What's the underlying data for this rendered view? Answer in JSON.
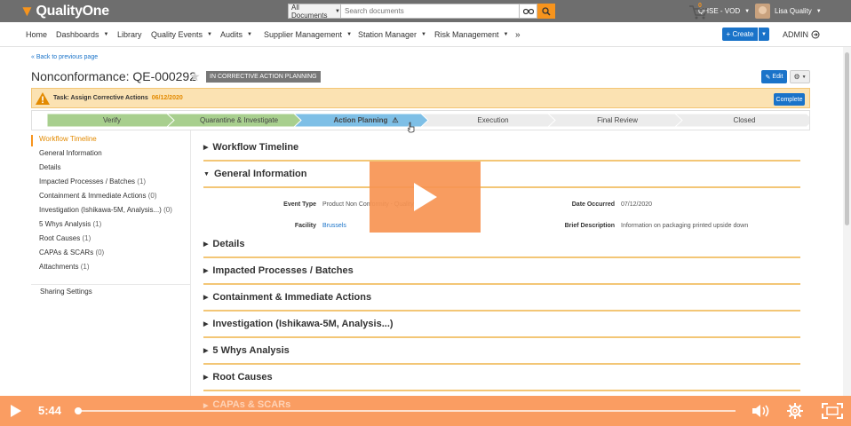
{
  "app": {
    "name": "QualityOne"
  },
  "search": {
    "scope": "All Documents",
    "placeholder": "Search documents"
  },
  "topbar": {
    "environment": "QHSE - VOD",
    "user_name": "Lisa Quality"
  },
  "nav": {
    "items": [
      "Home",
      "Dashboards",
      "Library",
      "Quality Events",
      "Audits",
      "Supplier Management",
      "Station Manager",
      "Risk Management"
    ],
    "cart_count": "0",
    "create_label": "+ Create",
    "admin_label": "ADMIN"
  },
  "page": {
    "back_link": "« Back to previous page",
    "title": "Nonconformance: QE-000292",
    "status": "IN CORRECTIVE ACTION PLANNING",
    "edit_label": "Edit"
  },
  "task": {
    "label": "Task: Assign Corrective Actions",
    "date": "06/12/2020",
    "complete_label": "Complete"
  },
  "workflow": {
    "steps": [
      {
        "label": "Verify",
        "state": "done"
      },
      {
        "label": "Quarantine & Investigate",
        "state": "done"
      },
      {
        "label": "Action Planning",
        "state": "current"
      },
      {
        "label": "Execution",
        "state": "pending"
      },
      {
        "label": "Final Review",
        "state": "pending"
      },
      {
        "label": "Closed",
        "state": "pending"
      }
    ],
    "colors": {
      "done": "#a8cf8e",
      "current": "#7ebfe6",
      "pending": "#ececec"
    }
  },
  "sidebar": {
    "items": [
      {
        "label": "Workflow Timeline",
        "count": ""
      },
      {
        "label": "General Information",
        "count": ""
      },
      {
        "label": "Details",
        "count": ""
      },
      {
        "label": "Impacted Processes / Batches",
        "count": "(1)"
      },
      {
        "label": "Containment & Immediate Actions",
        "count": "(0)"
      },
      {
        "label": "Investigation (Ishikawa-5M, Analysis...)",
        "count": "(0)"
      },
      {
        "label": "5 Whys Analysis",
        "count": "(1)"
      },
      {
        "label": "Root Causes",
        "count": "(1)"
      },
      {
        "label": "CAPAs & SCARs",
        "count": "(0)"
      },
      {
        "label": "Attachments",
        "count": "(1)"
      }
    ],
    "sharing": "Sharing Settings"
  },
  "sections": {
    "workflow_timeline": "Workflow Timeline",
    "general_information": "General Information",
    "details": "Details",
    "impacted": "Impacted Processes / Batches",
    "containment": "Containment & Immediate Actions",
    "investigation": "Investigation (Ishikawa-5M, Analysis...)",
    "five_whys": "5 Whys Analysis",
    "root_causes": "Root Causes",
    "capas": "CAPAs & SCARs"
  },
  "general_info": {
    "event_type_label": "Event Type",
    "event_type_value": "Product Non Conformity - Quality",
    "date_occurred_label": "Date Occurred",
    "date_occurred_value": "07/12/2020",
    "facility_label": "Facility",
    "facility_value": "Brussels",
    "brief_description_label": "Brief Description",
    "brief_description_value": "Information on packaging printed upside down"
  },
  "video": {
    "time": "5:44",
    "progress": 0.005
  },
  "colors": {
    "accent": "#f7941d",
    "primary": "#1a73c9",
    "topbar": "#6e6e6e"
  }
}
